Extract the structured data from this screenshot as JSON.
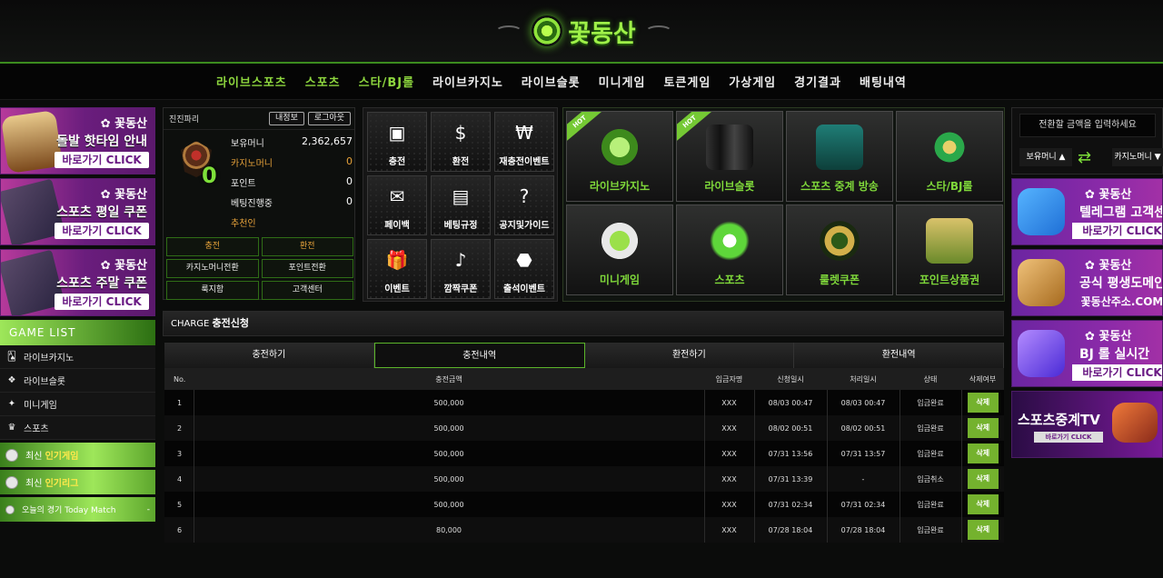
{
  "site": {
    "logo_text": "꽃동산"
  },
  "nav": [
    {
      "label": "라이브스포츠",
      "green": true
    },
    {
      "label": "스포츠",
      "green": true
    },
    {
      "label": "스타/BJ롤",
      "green": true
    },
    {
      "label": "라이브카지노",
      "green": false
    },
    {
      "label": "라이브슬롯",
      "green": false
    },
    {
      "label": "미니게임",
      "green": false
    },
    {
      "label": "토큰게임",
      "green": false
    },
    {
      "label": "가상게임",
      "green": false
    },
    {
      "label": "경기결과",
      "green": false
    },
    {
      "label": "배팅내역",
      "green": false
    }
  ],
  "left_banners": [
    {
      "brand": "꽃동산",
      "title": "돌발 핫타임 안내",
      "cta": "바로가기 CLICK"
    },
    {
      "brand": "꽃동산",
      "title": "스포츠 평일 쿠폰",
      "cta": "바로가기 CLICK"
    },
    {
      "brand": "꽃동산",
      "title": "스포츠 주말 쿠폰",
      "cta": "바로가기 CLICK"
    }
  ],
  "game_list": {
    "header": "GAME LIST",
    "items": [
      "라이브카지노",
      "라이브슬롯",
      "미니게임",
      "스포츠"
    ],
    "popular_games": {
      "prefix": "최신",
      "highlight": "인기게임"
    },
    "popular_leagues": {
      "prefix": "최신",
      "highlight": "인기리그"
    },
    "today": "오늘의 경기 Today Match"
  },
  "account": {
    "username": "진진파리",
    "btn_info": "내정보",
    "btn_logout": "로그아웃",
    "level": "0",
    "rows": [
      {
        "k": "보유머니",
        "v": "2,362,657",
        "orange": false
      },
      {
        "k": "카지노머니",
        "v": "0",
        "orange": true
      },
      {
        "k": "포인트",
        "v": "0",
        "orange": false
      },
      {
        "k": "베팅진행중",
        "v": "0",
        "orange": false
      },
      {
        "k": "추천인",
        "v": "",
        "orange": true
      }
    ],
    "buttons": [
      {
        "label": "충전",
        "orange": true
      },
      {
        "label": "환전",
        "orange": true
      },
      {
        "label": "카지노머니전환",
        "orange": false
      },
      {
        "label": "포인트전환",
        "orange": false
      },
      {
        "label": "룩지함",
        "orange": false
      },
      {
        "label": "고객센터",
        "orange": false
      }
    ]
  },
  "menu_tiles": [
    {
      "label": "충전",
      "icon": "atm-icon"
    },
    {
      "label": "환전",
      "icon": "withdraw-icon"
    },
    {
      "label": "재충전이벤트",
      "icon": "cash-icon"
    },
    {
      "label": "페이백",
      "icon": "envelope-icon"
    },
    {
      "label": "베팅규정",
      "icon": "document-icon"
    },
    {
      "label": "공지및가이드",
      "icon": "help-icon"
    },
    {
      "label": "이벤트",
      "icon": "gift-icon"
    },
    {
      "label": "깜짝쿠폰",
      "icon": "bell-icon"
    },
    {
      "label": "출석이벤트",
      "icon": "stamp-icon"
    }
  ],
  "game_tiles": [
    {
      "label": "라이브카지노",
      "hot": true
    },
    {
      "label": "라이브슬롯",
      "hot": true
    },
    {
      "label": "스포츠 중계 방송",
      "hot": false
    },
    {
      "label": "스타/BJ롤",
      "hot": false
    },
    {
      "label": "미니게임",
      "hot": false
    },
    {
      "label": "스포츠",
      "hot": false
    },
    {
      "label": "룰렛쿠폰",
      "hot": false
    },
    {
      "label": "포인트상품권",
      "hot": false
    }
  ],
  "hot_label": "HOT",
  "converter": {
    "placeholder": "전환할 금액을 입력하세요",
    "from": "보유머니 ▲",
    "to": "카지노머니 ▼"
  },
  "right_banners": [
    {
      "brand": "꽃동산",
      "title": "텔레그램 고객센터",
      "cta": "바로가기 CLICK"
    },
    {
      "brand": "꽃동산",
      "title": "공식 평생도메인",
      "cta": "꽃동산주소.COM"
    },
    {
      "brand": "꽃동산",
      "title": "BJ 롤 실시간",
      "cta": "바로가기 CLICK"
    },
    {
      "brand": "",
      "title": "스포츠중계TV",
      "cta": "바로가기 CLICK"
    }
  ],
  "charge": {
    "en": "CHARGE",
    "ko": "충전신청"
  },
  "tabs": [
    {
      "label": "충전하기",
      "active": false
    },
    {
      "label": "충전내역",
      "active": true
    },
    {
      "label": "환전하기",
      "active": false
    },
    {
      "label": "환전내역",
      "active": false
    }
  ],
  "table": {
    "headers": [
      "No.",
      "충전금액",
      "입금자명",
      "신청일시",
      "처리일시",
      "상태",
      "삭제여부"
    ],
    "delete_label": "삭제",
    "rows": [
      [
        "1",
        "500,000",
        "XXX",
        "08/03 00:47",
        "08/03 00:47",
        "입금완료"
      ],
      [
        "2",
        "500,000",
        "XXX",
        "08/02 00:51",
        "08/02 00:51",
        "입금완료"
      ],
      [
        "3",
        "500,000",
        "XXX",
        "07/31 13:56",
        "07/31 13:57",
        "입금완료"
      ],
      [
        "4",
        "500,000",
        "XXX",
        "07/31 13:39",
        "-",
        "입금취소"
      ],
      [
        "5",
        "500,000",
        "XXX",
        "07/31 02:34",
        "07/31 02:34",
        "입금완료"
      ],
      [
        "6",
        "80,000",
        "XXX",
        "07/28 18:04",
        "07/28 18:04",
        "입금완료"
      ]
    ]
  }
}
